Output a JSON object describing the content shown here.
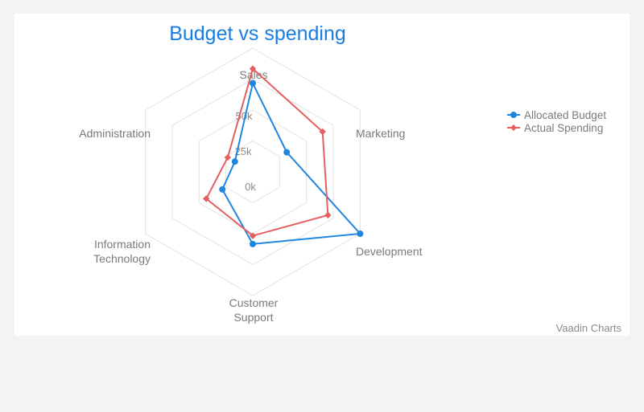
{
  "chart_data": {
    "type": "radar",
    "title": "Budget vs spending",
    "categories": [
      "Sales",
      "Marketing",
      "Development",
      "Customer Support",
      "Information Technology",
      "Administration"
    ],
    "ticks": [
      "0k",
      "25k",
      "50k"
    ],
    "ylim": [
      0,
      60000
    ],
    "grid": "polygon",
    "legend_position": "top-right",
    "series": [
      {
        "name": "Allocated Budget",
        "color": "#1f86e0",
        "marker": "circle",
        "values": [
          43000,
          19000,
          60000,
          35000,
          17000,
          10000
        ]
      },
      {
        "name": "Actual Spending",
        "color": "#e45f5f",
        "marker": "diamond",
        "values": [
          50000,
          39000,
          42000,
          31000,
          26000,
          14000
        ]
      }
    ],
    "credits": "Vaadin Charts"
  }
}
